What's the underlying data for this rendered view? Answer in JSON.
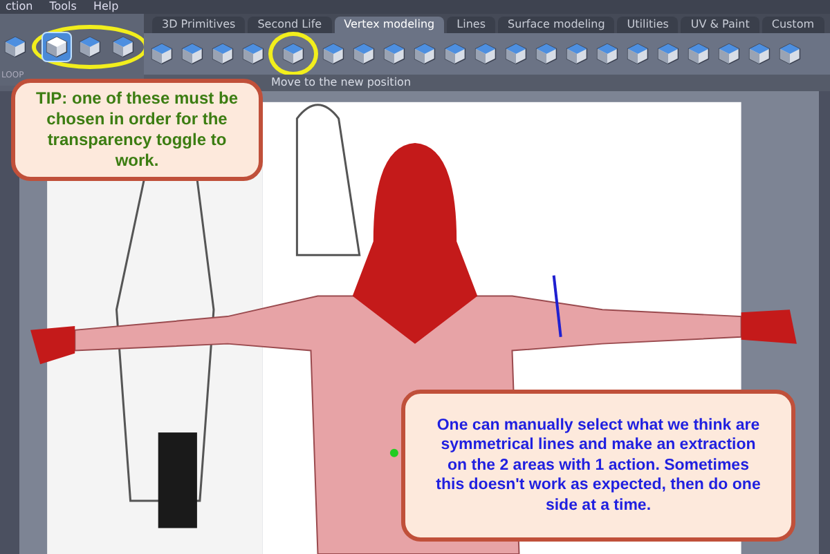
{
  "menu_bar": [
    "ction",
    "Tools",
    "Help"
  ],
  "left_toolbar": {
    "tools": [
      {
        "selected": false,
        "circled": false
      },
      {
        "selected": true,
        "circled": true
      },
      {
        "selected": false,
        "circled": true
      },
      {
        "selected": false,
        "circled": true
      }
    ],
    "caption": "LOOP"
  },
  "tabs": [
    {
      "label": "3D Primitives",
      "selected": false
    },
    {
      "label": "Second Life",
      "selected": false
    },
    {
      "label": "Vertex modeling",
      "selected": true
    },
    {
      "label": "Lines",
      "selected": false
    },
    {
      "label": "Surface modeling",
      "selected": false
    },
    {
      "label": "Utilities",
      "selected": false
    },
    {
      "label": "UV & Paint",
      "selected": false
    },
    {
      "label": "Custom",
      "selected": false
    }
  ],
  "tools": [
    {
      "circled": false
    },
    {
      "circled": false
    },
    {
      "circled": false
    },
    {
      "circled": false
    },
    {
      "circled": true
    },
    {
      "circled": false
    },
    {
      "circled": false
    },
    {
      "circled": false
    },
    {
      "circled": false
    },
    {
      "circled": false
    },
    {
      "circled": false
    },
    {
      "circled": false
    },
    {
      "circled": false
    },
    {
      "circled": false
    },
    {
      "circled": false
    },
    {
      "circled": false
    },
    {
      "circled": false
    },
    {
      "circled": false
    },
    {
      "circled": false
    },
    {
      "circled": false
    },
    {
      "circled": false
    }
  ],
  "status": "Move to the new position",
  "viewport": {
    "kind": "picture"
  },
  "notes": [
    {
      "kind": "tip",
      "text": "TIP: one of these must be chosen in order for the transparency toggle to work."
    },
    {
      "kind": "info",
      "text": "One can manually select what we think are symmetrical lines and make an extraction on the 2 areas with 1 action. Sometimes this doesn't work as expected, then do one side at a time."
    }
  ]
}
